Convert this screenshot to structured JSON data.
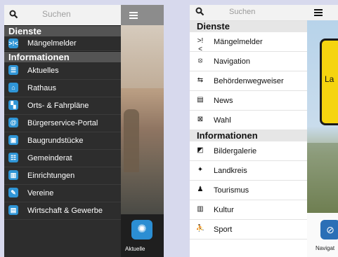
{
  "dark": {
    "search_placeholder": "Suchen",
    "sections": {
      "services": "Dienste",
      "information": "Informationen"
    },
    "services": [
      {
        "label": "Mängelmelder",
        "icon": ">!<",
        "icon_name": "defect-report-icon"
      }
    ],
    "information": [
      {
        "label": "Aktuelles",
        "icon": "☰",
        "icon_name": "news-icon"
      },
      {
        "label": "Rathaus",
        "icon": "⌂",
        "icon_name": "townhall-icon"
      },
      {
        "label": "Orts- & Fahrpläne",
        "icon": "▚",
        "icon_name": "map-icon"
      },
      {
        "label": "Bürgerservice-Portal",
        "icon": "@",
        "icon_name": "email-icon"
      },
      {
        "label": "Baugrundstücke",
        "icon": "▣",
        "icon_name": "land-plot-icon"
      },
      {
        "label": "Gemeinderat",
        "icon": "☷",
        "icon_name": "council-icon"
      },
      {
        "label": "Einrichtungen",
        "icon": "▥",
        "icon_name": "facilities-icon"
      },
      {
        "label": "Vereine",
        "icon": "✎",
        "icon_name": "clubs-icon"
      },
      {
        "label": "Wirtschaft & Gewerbe",
        "icon": "▤",
        "icon_name": "business-icon"
      }
    ],
    "bottom_tile_label": "Aktuelle",
    "accent_color": "#2f95d6"
  },
  "light": {
    "search_placeholder": "Suchen",
    "sections": {
      "services": "Dienste",
      "information": "Informationen"
    },
    "services": [
      {
        "label": "Mängelmelder",
        "icon": ">!<",
        "icon_name": "defect-report-icon"
      },
      {
        "label": "Navigation",
        "icon": "⦻",
        "icon_name": "navigation-icon"
      },
      {
        "label": "Behördenwegweiser",
        "icon": "⇆",
        "icon_name": "signpost-icon"
      },
      {
        "label": "News",
        "icon": "▤",
        "icon_name": "news-icon"
      },
      {
        "label": "Wahl",
        "icon": "⊠",
        "icon_name": "election-icon"
      }
    ],
    "information": [
      {
        "label": "Bildergalerie",
        "icon": "◩",
        "icon_name": "gallery-icon"
      },
      {
        "label": "Landkreis",
        "icon": "✦",
        "icon_name": "district-icon"
      },
      {
        "label": "Tourismus",
        "icon": "♟",
        "icon_name": "tourism-icon"
      },
      {
        "label": "Kultur",
        "icon": "▥",
        "icon_name": "culture-icon"
      },
      {
        "label": "Sport",
        "icon": "⛹",
        "icon_name": "sport-icon"
      }
    ],
    "sign_text": "La",
    "bottom_tile_label": "Navigat"
  }
}
